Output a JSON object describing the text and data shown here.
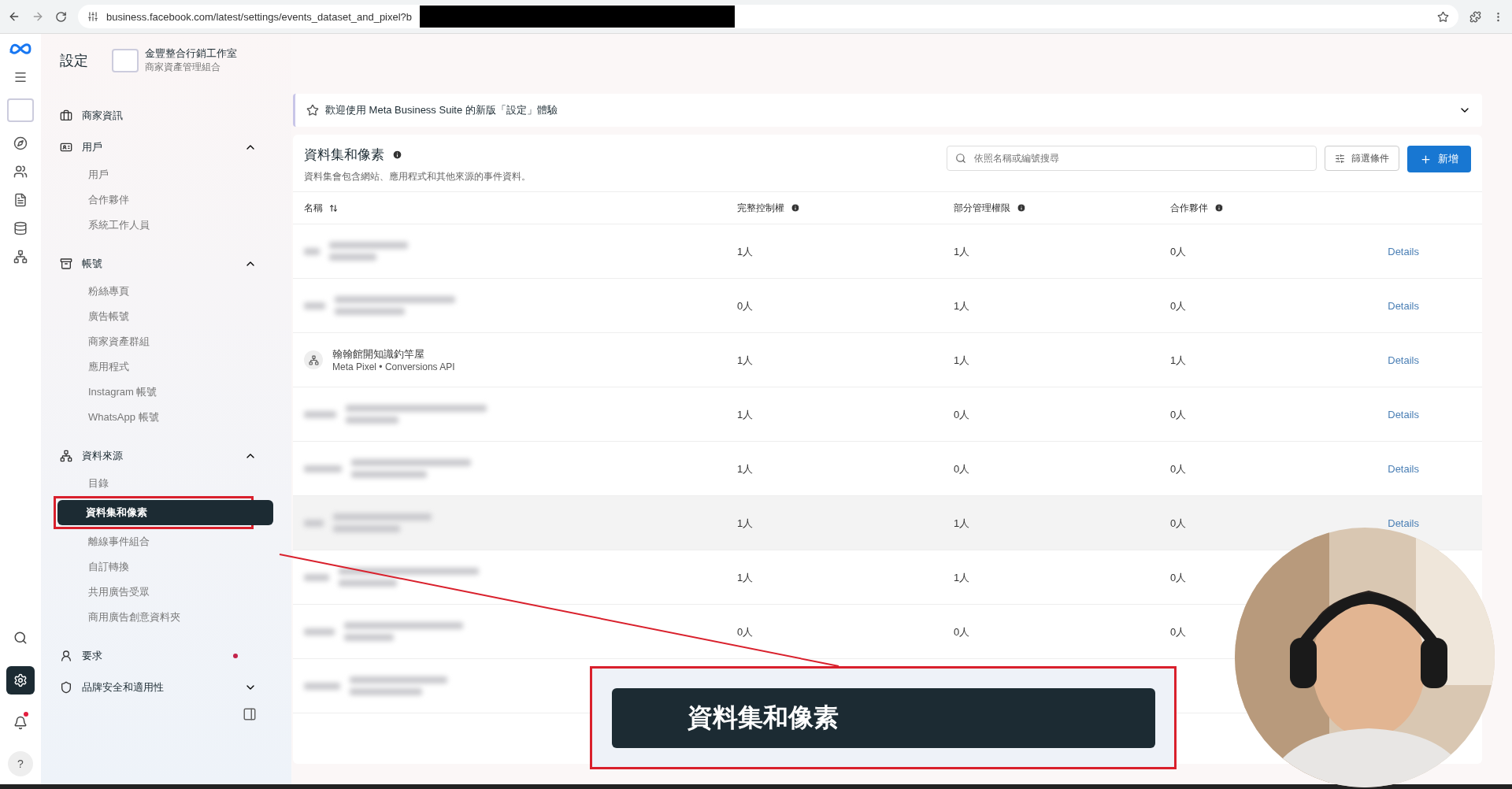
{
  "browser": {
    "url": "business.facebook.com/latest/settings/events_dataset_and_pixel?b"
  },
  "rail": {
    "bottom": [
      {
        "kind": "search",
        "selected": false
      },
      {
        "kind": "settings",
        "selected": true
      },
      {
        "kind": "bell",
        "selected": false,
        "alert": true
      },
      {
        "kind": "help",
        "selected": false,
        "label": "?"
      }
    ]
  },
  "header": {
    "title": "設定",
    "business_name": "金豐整合行銷工作室",
    "business_type": "商家資產管理組合"
  },
  "sidebar": {
    "sections": [
      {
        "label": "商家資訊"
      },
      {
        "label": "用戶",
        "expanded": true,
        "items": [
          {
            "label": "用戶",
            "selected": false
          },
          {
            "label": "合作夥伴",
            "selected": false
          },
          {
            "label": "系統工作人員",
            "selected": false
          }
        ]
      },
      {
        "label": "帳號",
        "expanded": true,
        "items": [
          {
            "label": "粉絲專頁",
            "selected": false
          },
          {
            "label": "廣告帳號",
            "selected": false
          },
          {
            "label": "商家資產群組",
            "selected": false
          },
          {
            "label": "應用程式",
            "selected": false
          },
          {
            "label": "Instagram 帳號",
            "selected": false
          },
          {
            "label": "WhatsApp 帳號",
            "selected": false
          }
        ]
      },
      {
        "label": "資料來源",
        "expanded": true,
        "items": [
          {
            "label": "目錄",
            "selected": false
          },
          {
            "label": "資料集和像素",
            "selected": true,
            "highlighted": true
          },
          {
            "label": "離線事件組合",
            "selected": false
          },
          {
            "label": "自訂轉換",
            "selected": false
          },
          {
            "label": "共用廣告受眾",
            "selected": false
          },
          {
            "label": "商用廣告創意資料夾",
            "selected": false
          }
        ]
      },
      {
        "label": "要求",
        "alert": true
      },
      {
        "label": "品牌安全和適用性",
        "expanded": false
      }
    ]
  },
  "banner": {
    "text": "歡迎使用 Meta Business Suite 的新版「設定」體驗"
  },
  "panel": {
    "title": "資料集和像素",
    "description": "資料集會包含網站、應用程式和其他來源的事件資料。",
    "search": {
      "placeholder": "依照名稱或編號搜尋"
    },
    "filter_button": "篩選條件",
    "new_button": "新增"
  },
  "table": {
    "columns": [
      {
        "label": "名稱",
        "kind": "sort"
      },
      {
        "label": "完整控制權",
        "kind": "info"
      },
      {
        "label": "部分管理權限",
        "kind": "info"
      },
      {
        "label": "合作夥伴",
        "kind": "info"
      }
    ],
    "rows": [
      {
        "kind": "blurred",
        "full_control": "1人",
        "partial_admin": "1人",
        "partners": "0人",
        "details": "Details"
      },
      {
        "kind": "blurred",
        "full_control": "0人",
        "partial_admin": "1人",
        "partners": "0人",
        "details": "Details"
      },
      {
        "kind": "named",
        "name": "翰翰館開知識釣竿屋",
        "subtitle": "Meta Pixel • Conversions API",
        "full_control": "1人",
        "partial_admin": "1人",
        "partners": "1人",
        "details": "Details"
      },
      {
        "kind": "blurred",
        "full_control": "1人",
        "partial_admin": "0人",
        "partners": "0人",
        "details": "Details"
      },
      {
        "kind": "blurred",
        "full_control": "1人",
        "partial_admin": "0人",
        "partners": "0人",
        "details": "Details"
      },
      {
        "kind": "blurred",
        "hovered": true,
        "full_control": "1人",
        "partial_admin": "1人",
        "partners": "0人",
        "details": "Details"
      },
      {
        "kind": "blurred",
        "full_control": "1人",
        "partial_admin": "1人",
        "partners": "0人"
      },
      {
        "kind": "blurred",
        "full_control": "0人",
        "partial_admin": "0人",
        "partners": "0人"
      },
      {
        "kind": "blurred"
      }
    ]
  },
  "zoom_callout": {
    "text": "資料集和像素"
  }
}
